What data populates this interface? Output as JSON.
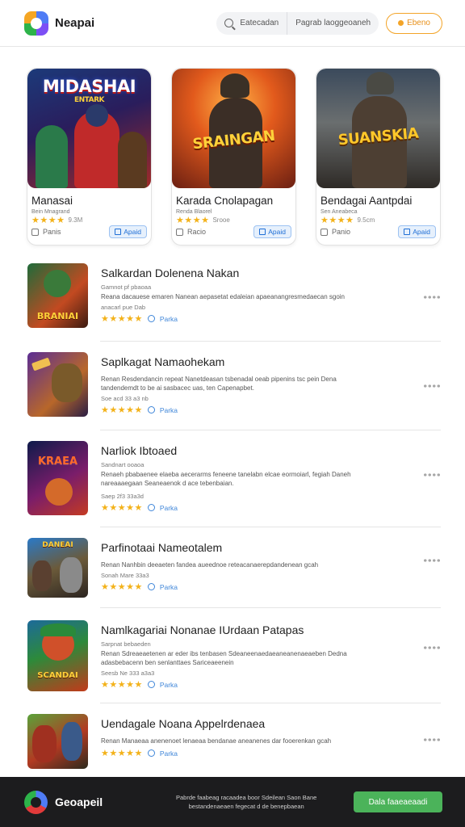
{
  "header": {
    "brand": "Neapai",
    "search_left": "Eatecadan",
    "search_right": "Pagrab laoggeoaneh",
    "cta_label": "Ebeno"
  },
  "featured": [
    {
      "art_title": "MIDASHAI",
      "art_sub": "ENTARK",
      "title": "Manasai",
      "subtitle": "Bein Mnagrand",
      "rating_text": "9.3M",
      "foot_label": "Panis",
      "button": "Apaid"
    },
    {
      "art_title": "SRAINGAN",
      "art_sub": "",
      "title": "Karada Cnolapagan",
      "subtitle": "Renda Blaorel",
      "rating_text": "Srooe",
      "foot_label": "Racio",
      "button": "Apaid"
    },
    {
      "art_title": "SUANSKIA",
      "art_sub": "",
      "title": "Bendagai Aantpdai",
      "subtitle": "Sen Aneabeca",
      "rating_text": "9.5cm",
      "foot_label": "Panio",
      "button": "Apaid"
    }
  ],
  "list": [
    {
      "title": "Salkardan Dolenena Nakan",
      "meta": "Gamnot pf pbaoaa",
      "desc": "Reana dacauese emaren Nanean aepasetat edaleian apaeanangresmedaecan sgoin",
      "extra": "anacarl pue Dab",
      "size": "",
      "rating_label": "Parka",
      "thumb_text": "BRANIAI"
    },
    {
      "title": "Saplkagat Namaohekam",
      "meta": "",
      "desc": "Renan Resdendancin repeat Nanetdeasan tsbenadal oeab pipenins tsc pein Dena tandendemdt to be ai sasbacec uas, ten Capenapbet.",
      "extra": "",
      "size": "Soe acd 33 a3 nb",
      "rating_label": "Parka",
      "thumb_text": ""
    },
    {
      "title": "Narliok Ibtoaed",
      "meta": "Sandnart ooaoa",
      "desc": "Renaeh pbabaenee elaeba aecerarms feneene tanelabn elcae eormoiarl, fegiah Daneh nareaaaegaan Seaneaenok d ace tebenbaian.",
      "extra": "",
      "size": "Saep 2f3 33a3d",
      "rating_label": "Parka",
      "thumb_text": "KRAEA"
    },
    {
      "title": "Parfinotaai Nameotalem",
      "meta": "",
      "desc": "Renan Nanhbin deeaeten fandea aueednoe reteacanaerepdandenean gcah",
      "extra": "",
      "size": "Sonah Mare 33a3",
      "rating_label": "Parka",
      "thumb_text": "DANEAI"
    },
    {
      "title": "Namlkagariai Nonanae IUrdaan Patapas",
      "meta": "Sarpnat bebaeden",
      "desc": "Renan Sdreaeaetenen ar eder ibs tenbasen Sdeaneenaedaeaneanenaeaeben Dedna adasbebacenn ben senlanttaes Sariceaeenein",
      "extra": "",
      "size": "Seesb Ne 333 a3a3",
      "rating_label": "Parka",
      "thumb_text": "SCANDAI"
    },
    {
      "title": "Uendagale Noana Appelrdenaea",
      "meta": "",
      "desc": "Renan Manaeaa anenenoet lenaeaa bendanae aneanenes dar fooerenkan gcah",
      "extra": "",
      "size": "",
      "rating_label": "Parka",
      "thumb_text": ""
    }
  ],
  "footer": {
    "brand": "Geoapeil",
    "text": "Pabrde faabeag racaadea boor Sdeilean Saon Bane bestandenaeaen fegecat d de benepbaean",
    "button": "Dala faaeaeaadi"
  }
}
